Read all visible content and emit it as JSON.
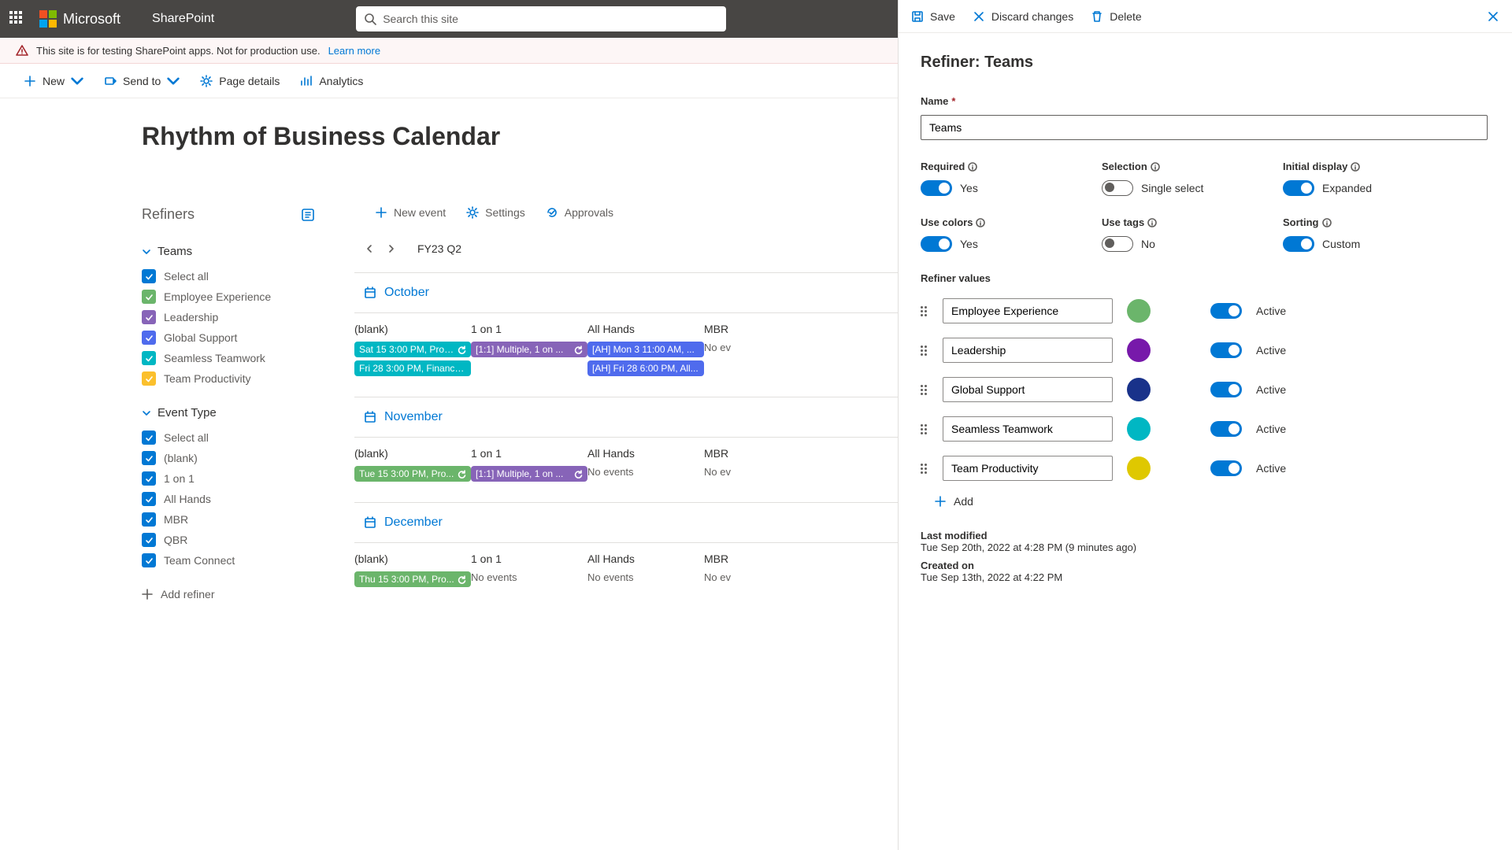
{
  "topbar": {
    "brand": "Microsoft",
    "product": "SharePoint",
    "search_placeholder": "Search this site"
  },
  "notice": {
    "text": "This site is for testing SharePoint apps. Not for production use.",
    "link": "Learn more"
  },
  "cmdbar": {
    "new": "New",
    "send_to": "Send to",
    "page_details": "Page details",
    "analytics": "Analytics"
  },
  "page": {
    "title": "Rhythm of Business Calendar"
  },
  "refiners": {
    "heading": "Refiners",
    "groups": [
      {
        "name": "Teams",
        "items": [
          {
            "label": "Select all",
            "color": "blue"
          },
          {
            "label": "Employee Experience",
            "color": "green"
          },
          {
            "label": "Leadership",
            "color": "purple"
          },
          {
            "label": "Global Support",
            "color": "dblue"
          },
          {
            "label": "Seamless Teamwork",
            "color": "teal"
          },
          {
            "label": "Team Productivity",
            "color": "yellow"
          }
        ]
      },
      {
        "name": "Event Type",
        "items": [
          {
            "label": "Select all",
            "color": "blue"
          },
          {
            "label": "(blank)",
            "color": "blue"
          },
          {
            "label": "1 on 1",
            "color": "blue"
          },
          {
            "label": "All Hands",
            "color": "blue"
          },
          {
            "label": "MBR",
            "color": "blue"
          },
          {
            "label": "QBR",
            "color": "blue"
          },
          {
            "label": "Team Connect",
            "color": "blue"
          }
        ]
      }
    ],
    "add": "Add refiner"
  },
  "calendar": {
    "toolbar": {
      "new_event": "New event",
      "settings": "Settings",
      "approvals": "Approvals"
    },
    "period": "FY23 Q2",
    "columns": [
      "(blank)",
      "1 on 1",
      "All Hands",
      "MBR"
    ],
    "months": [
      {
        "name": "October",
        "rows": {
          "blank": [
            {
              "text": "Sat 15 3:00 PM, Prod...",
              "color": "teal",
              "recur": true
            },
            {
              "text": "Fri 28 3:00 PM, Financia...",
              "color": "teal",
              "recur": false
            }
          ],
          "one": [
            {
              "text": "[1:1]  Multiple, 1 on ...",
              "color": "purple",
              "recur": true
            }
          ],
          "all": [
            {
              "text": "[AH]  Mon 3 11:00 AM, ...",
              "color": "dblue",
              "recur": false
            },
            {
              "text": "[AH]  Fri 28 6:00 PM, All...",
              "color": "dblue",
              "recur": false
            }
          ],
          "mbr": "No ev"
        }
      },
      {
        "name": "November",
        "rows": {
          "blank": [
            {
              "text": "Tue 15 3:00 PM, Pro...",
              "color": "green",
              "recur": true
            }
          ],
          "one": [
            {
              "text": "[1:1]  Multiple, 1 on ...",
              "color": "purple",
              "recur": true
            }
          ],
          "all": "No events",
          "mbr": "No ev"
        }
      },
      {
        "name": "December",
        "rows": {
          "blank": [
            {
              "text": "Thu 15 3:00 PM, Pro...",
              "color": "green",
              "recur": true
            }
          ],
          "one": "No events",
          "all": "No events",
          "mbr": "No ev"
        }
      }
    ]
  },
  "panel": {
    "actions": {
      "save": "Save",
      "discard": "Discard changes",
      "delete": "Delete"
    },
    "title": "Refiner: Teams",
    "fields": {
      "name_label": "Name",
      "name_value": "Teams",
      "required_label": "Required",
      "required_value": "Yes",
      "selection_label": "Selection",
      "selection_value": "Single select",
      "initial_label": "Initial display",
      "initial_value": "Expanded",
      "colors_label": "Use colors",
      "colors_value": "Yes",
      "tags_label": "Use tags",
      "tags_value": "No",
      "sorting_label": "Sorting",
      "sorting_value": "Custom"
    },
    "values_label": "Refiner values",
    "values": [
      {
        "name": "Employee Experience",
        "swatch": "sw-green",
        "active": "Active"
      },
      {
        "name": "Leadership",
        "swatch": "sw-purple",
        "active": "Active"
      },
      {
        "name": "Global Support",
        "swatch": "sw-dblue",
        "active": "Active"
      },
      {
        "name": "Seamless Teamwork",
        "swatch": "sw-teal",
        "active": "Active"
      },
      {
        "name": "Team Productivity",
        "swatch": "sw-yellow",
        "active": "Active"
      }
    ],
    "add": "Add",
    "meta": {
      "modified_label": "Last modified",
      "modified": "Tue Sep 20th, 2022 at 4:28 PM (9 minutes ago)",
      "created_label": "Created on",
      "created": "Tue Sep 13th, 2022 at 4:22 PM"
    }
  }
}
